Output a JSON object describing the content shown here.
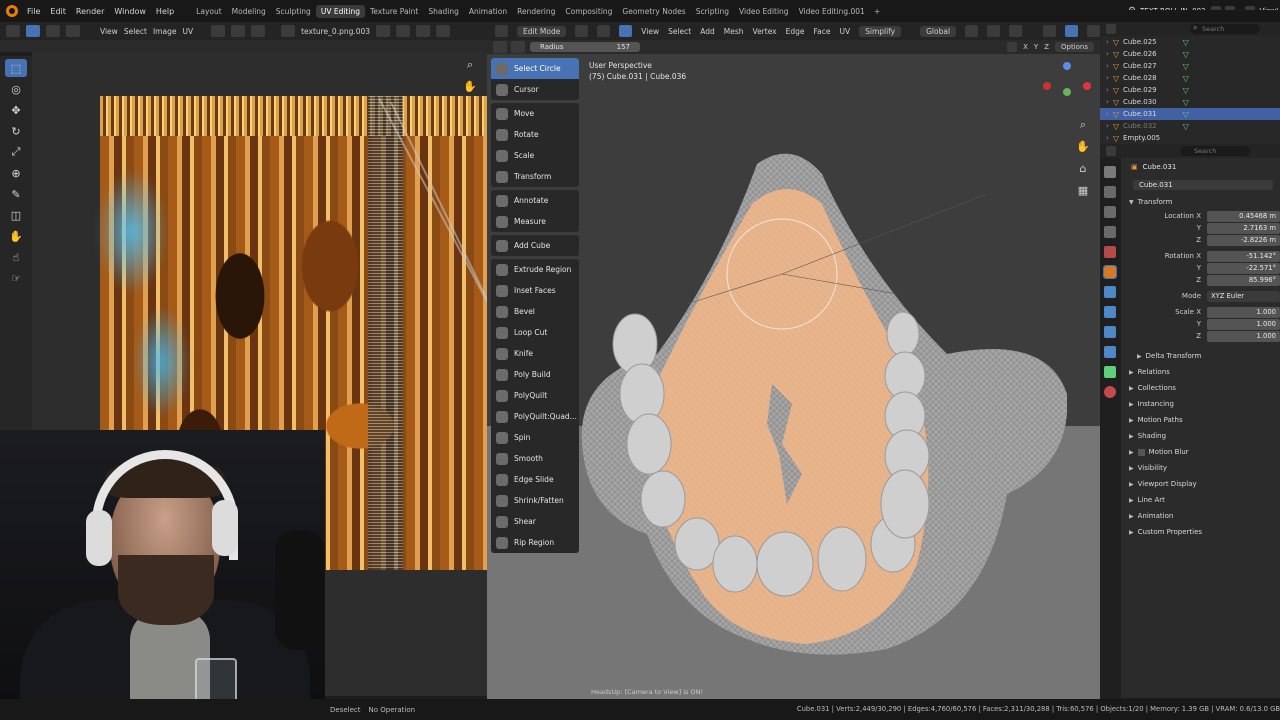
{
  "menu": {
    "items": [
      "File",
      "Edit",
      "Render",
      "Window",
      "Help"
    ],
    "workspaces": [
      "Layout",
      "Modeling",
      "Sculpting",
      "UV Editing",
      "Texture Paint",
      "Shading",
      "Animation",
      "Rendering",
      "Compositing",
      "Geometry Nodes",
      "Scripting",
      "Video Editing",
      "Video Editing.001"
    ],
    "active_workspace": "UV Editing",
    "scene": "TEXT ROLL IN .003",
    "view_layer": "ViewL"
  },
  "uv_editor": {
    "menus": [
      "View",
      "Select",
      "Image",
      "UV"
    ],
    "image_name": "texture_0.png.003"
  },
  "viewport": {
    "mode": "Edit Mode",
    "menus": [
      "View",
      "Select",
      "Add",
      "Mesh",
      "Vertex",
      "Edge",
      "Face",
      "UV"
    ],
    "simplify": "Simplify",
    "orientation": "Global",
    "options": "Options",
    "axes": [
      "X",
      "Y",
      "Z"
    ],
    "radius_label": "Radius",
    "radius_value": "157",
    "perspective": "User Perspective",
    "object_info": "(75) Cube.031 | Cube.036",
    "headsup": "HeadsUp: [Camera to View] is ON!"
  },
  "tools": [
    {
      "group": 1,
      "items": [
        {
          "label": "Select Circle",
          "active": true
        },
        {
          "label": "Cursor",
          "active": false
        }
      ]
    },
    {
      "group": 2,
      "items": [
        {
          "label": "Move"
        },
        {
          "label": "Rotate"
        },
        {
          "label": "Scale"
        },
        {
          "label": "Transform"
        }
      ]
    },
    {
      "group": 3,
      "items": [
        {
          "label": "Annotate"
        },
        {
          "label": "Measure"
        }
      ]
    },
    {
      "group": 4,
      "items": [
        {
          "label": "Add Cube"
        }
      ]
    },
    {
      "group": 5,
      "items": [
        {
          "label": "Extrude Region"
        },
        {
          "label": "Inset Faces"
        },
        {
          "label": "Bevel"
        },
        {
          "label": "Loop Cut"
        },
        {
          "label": "Knife"
        },
        {
          "label": "Poly Build"
        },
        {
          "label": "PolyQuilt"
        },
        {
          "label": "PolyQuilt:Quad..."
        },
        {
          "label": "Spin"
        },
        {
          "label": "Smooth"
        },
        {
          "label": "Edge Slide"
        },
        {
          "label": "Shrink/Fatten"
        },
        {
          "label": "Shear"
        },
        {
          "label": "Rip Region"
        }
      ]
    }
  ],
  "outliner": {
    "search_placeholder": "Search",
    "rows": [
      {
        "name": "Cube.025",
        "selected": false,
        "dim": false
      },
      {
        "name": "Cube.026",
        "selected": false,
        "dim": false
      },
      {
        "name": "Cube.027",
        "selected": false,
        "dim": false
      },
      {
        "name": "Cube.028",
        "selected": false,
        "dim": false
      },
      {
        "name": "Cube.029",
        "selected": false,
        "dim": false
      },
      {
        "name": "Cube.030",
        "selected": false,
        "dim": false
      },
      {
        "name": "Cube.031",
        "selected": true,
        "dim": false
      },
      {
        "name": "Cube.032",
        "selected": false,
        "dim": true
      },
      {
        "name": "Empty.005",
        "selected": false,
        "dim": false
      }
    ]
  },
  "properties": {
    "search_placeholder": "Search",
    "object": "Cube.031",
    "datablock": "Cube.031",
    "transform_label": "Transform",
    "location_label": "Location X",
    "location": [
      "0.45468 m",
      "2.7163 m",
      "-2.8226 m"
    ],
    "rotation_label": "Rotation X",
    "rotation": [
      "-51.142°",
      "-22.571°",
      "85.996°"
    ],
    "mode_label": "Mode",
    "mode_value": "XYZ Euler",
    "scale_label": "Scale X",
    "scale": [
      "1.000",
      "1.000",
      "1.000"
    ],
    "y_label": "Y",
    "z_label": "Z",
    "sections": [
      "Delta Transform",
      "Relations",
      "Collections",
      "Instancing",
      "Motion Paths",
      "Shading",
      "Motion Blur",
      "Visibility",
      "Viewport Display",
      "Line Art",
      "Animation",
      "Custom Properties"
    ]
  },
  "status": {
    "left_a": "Deselect",
    "left_b": "No Operation",
    "right": "Cube.031 | Verts:2,449/30,290 | Edges:4,760/60,576 | Faces:2,311/30,288 | Tris:60,576 | Objects:1/20 | Memory: 1.39 GB | VRAM: 0.6/13.0 GB"
  },
  "colors": {
    "accent": "#4772b3",
    "blender_orange": "#e87d0d",
    "mesh_skin": "#e8b48c",
    "mesh_grey": "#9a9a9a"
  }
}
